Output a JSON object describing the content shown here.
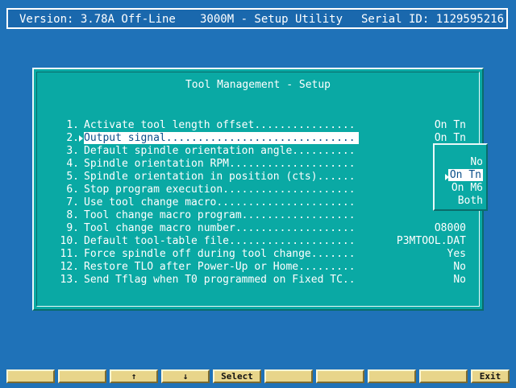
{
  "status_bar": {
    "version": "Version: 3.78A Off-Line",
    "app_title": "3000M - Setup Utility",
    "serial": "Serial ID: 1129595216"
  },
  "dialog": {
    "title": "Tool Management - Setup",
    "items": [
      {
        "num": "1.",
        "label": "Activate tool length offset................",
        "value": "On Tn"
      },
      {
        "num": "2.",
        "label": "Output signal..............................",
        "value": "On Tn",
        "selected": true
      },
      {
        "num": "3.",
        "label": "Default spindle orientation angle..........",
        "value": ""
      },
      {
        "num": "4.",
        "label": "Spindle orientation RPM....................",
        "value": ""
      },
      {
        "num": "5.",
        "label": "Spindle orientation in position (cts)......",
        "value": ""
      },
      {
        "num": "6.",
        "label": "Stop program execution.....................",
        "value": ""
      },
      {
        "num": "7.",
        "label": "Use tool change macro......................",
        "value": ""
      },
      {
        "num": "8.",
        "label": "Tool change macro program..................",
        "value": ""
      },
      {
        "num": "9.",
        "label": "Tool change macro number...................",
        "value": "O8000"
      },
      {
        "num": "10.",
        "label": "Default tool-table file....................",
        "value": "P3MTOOL.DAT"
      },
      {
        "num": "11.",
        "label": "Force spindle off during tool change.......",
        "value": "Yes"
      },
      {
        "num": "12.",
        "label": "Restore TLO after Power-Up or Home.........",
        "value": "No"
      },
      {
        "num": "13.",
        "label": "Send Tflag when T0 programmed on Fixed TC..",
        "value": "No"
      }
    ]
  },
  "popup": {
    "options": [
      "No",
      "On Tn",
      "On M6",
      "Both"
    ],
    "selected": "On Tn"
  },
  "fkeys": [
    "",
    "",
    "↑",
    "↓",
    "Select",
    "",
    "",
    "",
    "",
    "Exit"
  ],
  "colors": {
    "background": "#1f72b8",
    "panel": "#0aa9a4",
    "fkey": "#e8d58a"
  }
}
